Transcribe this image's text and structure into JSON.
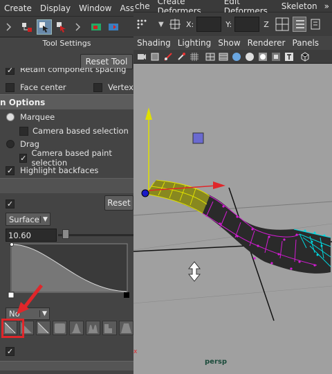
{
  "left_menu": [
    "Create",
    "Display",
    "Window",
    "Assets"
  ],
  "right_menu": [
    "che",
    "Create Deformers",
    "Edit Deformers",
    "Skeleton"
  ],
  "overflow_glyph": "»",
  "tool_settings_label": "Tool Settings",
  "reset_tool_label": "Reset Tool",
  "top_clipped_option": "Retain component spacing",
  "face_center_label": "Face center",
  "vertex_label": "Vertex",
  "section_title": "n Options",
  "marquee_label": "Marquee",
  "camera_based_selection_label": "Camera based selection",
  "drag_label": "Drag",
  "camera_based_paint_label": "Camera based paint selection",
  "highlight_backfaces_label": "Highlight backfaces",
  "reset_label": "Reset",
  "falloff_mode": "Surface",
  "falloff_radius": "10.60",
  "interp_dropdown": "No",
  "coord_x_label": "X:",
  "coord_y_label": "Y:",
  "coord_z_label": "Z",
  "panel_menu": [
    "Shading",
    "Lighting",
    "Show",
    "Renderer",
    "Panels"
  ],
  "camera_label": "persp",
  "axis_glyph": "x",
  "colors": {
    "accent_red": "#e0262a",
    "curve_yellow": "#e0e000",
    "surface_magenta": "#d41bd4",
    "cyan_edges": "#00d8e0",
    "viewport_bg": "#a0a0a0"
  }
}
